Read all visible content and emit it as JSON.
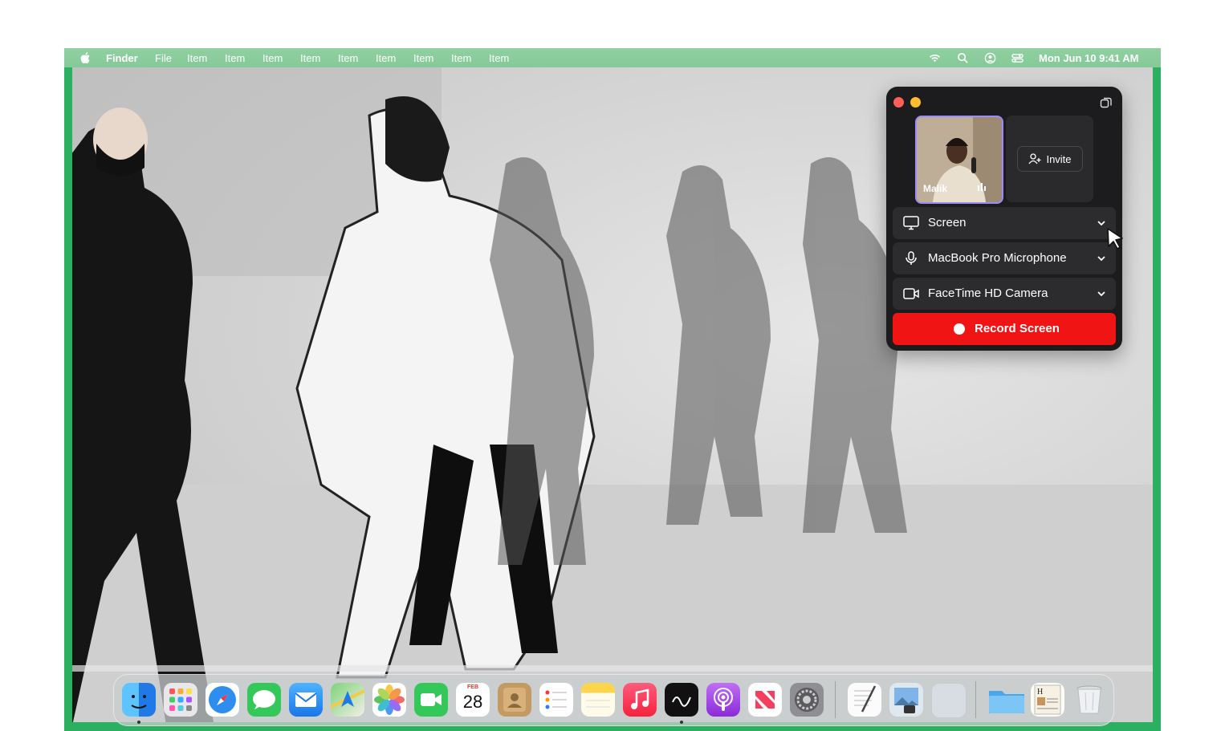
{
  "menubar": {
    "app_name": "Finder",
    "items": [
      "File",
      "Item",
      "Item",
      "Item",
      "Item",
      "Item",
      "Item",
      "Item",
      "Item",
      "Item"
    ],
    "clock": "Mon Jun 10  9:41 AM",
    "status_icons": [
      "wifi-icon",
      "search-icon",
      "user-icon",
      "control-center-icon"
    ]
  },
  "panel": {
    "participant_name": "Malik",
    "invite_label": "Invite",
    "source_screen": "Screen",
    "source_microphone": "MacBook Pro Microphone",
    "source_camera": "FaceTime HD Camera",
    "record_label": "Record Screen"
  },
  "dock": {
    "calendar_month": "FEB",
    "calendar_day": "28",
    "apps": [
      "finder-icon",
      "launchpad-icon",
      "safari-icon",
      "messages-icon",
      "mail-icon",
      "maps-icon",
      "photos-icon",
      "facetime-icon",
      "calendar-icon",
      "contacts-icon",
      "reminders-icon",
      "notes-icon",
      "music-icon",
      "stocks-icon",
      "podcasts-icon",
      "news-icon",
      "system-settings-icon",
      "textedit-icon",
      "preview-icon",
      "blank-app-icon",
      "folder-icon",
      "document-icon",
      "trash-icon"
    ]
  },
  "colors": {
    "frame_green": "#2bb062",
    "record_red": "#f01414",
    "panel_bg": "#1c1c1e"
  }
}
